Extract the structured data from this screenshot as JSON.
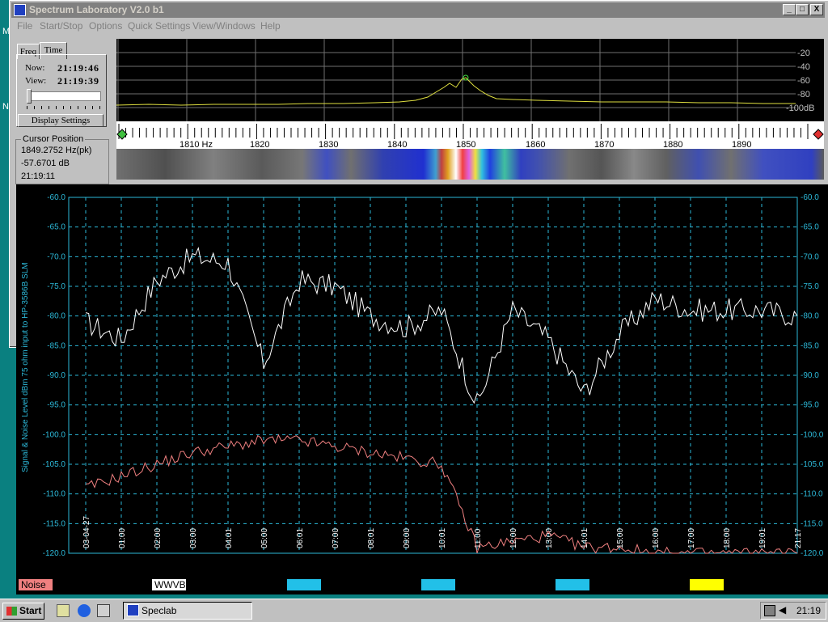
{
  "app": {
    "title": "Spectrum Laboratory V2.0 b1",
    "window_buttons": {
      "minimize": "_",
      "maximize": "□",
      "close": "X"
    }
  },
  "menu": [
    "File",
    "Start/Stop",
    "Options",
    "Quick Settings",
    "View/Windows",
    "Help"
  ],
  "tabs": {
    "freq": "Freq",
    "time": "Time"
  },
  "time_panel": {
    "now_label": "Now:",
    "now_value": "21:19:46",
    "view_label": "View:",
    "view_value": "21:19:39",
    "display_settings": "Display Settings"
  },
  "cursor_position": {
    "label": "Cursor Position",
    "freq": "1849.2752 Hz(pk)",
    "level": "-57.6701 dB",
    "time": "21:19:11"
  },
  "spectrum": {
    "db_labels": [
      "-20",
      "-40",
      "-60",
      "-80",
      "-100dB"
    ],
    "freq_labels": [
      "1810 Hz",
      "1820",
      "1830",
      "1840",
      "1850",
      "1860",
      "1870",
      "1880",
      "1890"
    ]
  },
  "side_labels": [
    "M",
    "N"
  ],
  "plot": {
    "ylabel": "Signal & Noise Level dBm 75 ohm input to HP-3586B SLM",
    "y_ticks": [
      "-60.0",
      "-65.0",
      "-70.0",
      "-75.0",
      "-80.0",
      "-85.0",
      "-90.0",
      "-95.0",
      "-100.0",
      "-105.0",
      "-110.0",
      "-115.0",
      "-120.0"
    ],
    "x_ticks": [
      "03-04-27",
      "01:00",
      "02:00",
      "03:00",
      "04:01",
      "05:00",
      "06:01",
      "07:00",
      "08:01",
      "09:00",
      "10:01",
      "11:00",
      "12:00",
      "13:00",
      "14:01",
      "15:00",
      "16:00",
      "17:00",
      "18:00",
      "19:01",
      "21:17"
    ],
    "legend": [
      {
        "label": "Noise",
        "color": "#f08080"
      },
      {
        "label": "WWVB",
        "color": "#ffffff"
      },
      {
        "label": "",
        "color": "#22c0e8"
      },
      {
        "label": "",
        "color": "#22c0e8"
      },
      {
        "label": "",
        "color": "#22c0e8"
      },
      {
        "label": "",
        "color": "#ffff00"
      }
    ],
    "colors": {
      "grid": "#2cb8d8",
      "signal": "#ffffff",
      "noise": "#f08080",
      "axis": "#2cb8d8"
    }
  },
  "chart_data": {
    "type": "line",
    "ylim": [
      -120,
      -60
    ],
    "x": [
      "03-04-27",
      "01:00",
      "02:00",
      "03:00",
      "04:01",
      "05:00",
      "06:01",
      "07:00",
      "08:01",
      "09:00",
      "10:01",
      "11:00",
      "12:00",
      "13:00",
      "14:01",
      "15:00",
      "16:00",
      "17:00",
      "18:00",
      "19:01",
      "21:17"
    ],
    "series": [
      {
        "name": "WWVB",
        "values": [
          -81,
          -84,
          -74,
          -70,
          -71,
          -88,
          -74,
          -75,
          -80,
          -82,
          -79,
          -95,
          -79,
          -84,
          -93,
          -83,
          -77,
          -79,
          -79,
          -79,
          -80
        ]
      },
      {
        "name": "Noise",
        "values": [
          -109,
          -107,
          -105,
          -103,
          -102,
          -101,
          -101,
          -102,
          -103,
          -104,
          -105,
          -119,
          -118,
          -117,
          -119,
          -119,
          -120,
          -120,
          -120,
          -120,
          -120
        ]
      }
    ]
  },
  "taskbar": {
    "start": "Start",
    "task": "Speclab",
    "clock": "21:19"
  }
}
